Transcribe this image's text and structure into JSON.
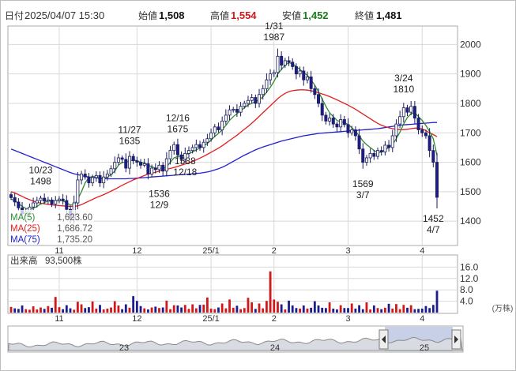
{
  "header": {
    "date_label": "日付",
    "datetime": "2025/04/07 15:30",
    "open_label": "始値",
    "open_value": "1,508",
    "high_label": "高値",
    "high_value": "1,554",
    "low_label": "安値",
    "low_value": "1,452",
    "close_label": "終値",
    "close_value": "1,481"
  },
  "legend": {
    "ma5_label": "MA(5)",
    "ma5_value": "1,623.60",
    "ma25_label": "MA(25)",
    "ma25_value": "1,686.72",
    "ma75_label": "MA(75)",
    "ma75_value": "1,735.20"
  },
  "volume_header": {
    "label": "出来高",
    "value": "93,500株",
    "unit": "(万株)"
  },
  "colors": {
    "up": "#ffffff",
    "down": "#1c1c8c",
    "ma5": "#2e8b2e",
    "ma25": "#e02020",
    "ma75": "#2020d0",
    "volume_up": "#d01818",
    "volume_down": "#1c1c8c",
    "high_value": "#d01818",
    "low_value": "#1a7a1a",
    "grid": "#d8d8d8",
    "navigator_fill": "#c8d0e8"
  },
  "chart_data": {
    "type": "candlestick",
    "price_axis": {
      "ylim": [
        1320,
        2060
      ],
      "ticks": [
        "2000",
        "1900",
        "1800",
        "1700",
        "1600",
        "1500",
        "1400"
      ],
      "tick_values": [
        2000,
        1900,
        1800,
        1700,
        1600,
        1500,
        1400
      ]
    },
    "volume_axis": {
      "ylim": [
        0,
        20
      ],
      "ticks": [
        "16.0",
        "12.0",
        "8.0",
        "4.0"
      ],
      "tick_values": [
        16,
        12,
        8,
        4
      ]
    },
    "month_labels": [
      {
        "label": "11",
        "index": 13
      },
      {
        "label": "12",
        "index": 34
      },
      {
        "label": "25/1",
        "index": 54
      },
      {
        "label": "2",
        "index": 71
      },
      {
        "label": "3",
        "index": 91
      },
      {
        "label": "4",
        "index": 111
      }
    ],
    "annotations": [
      {
        "date": "10/23",
        "value": "1498",
        "index": 8,
        "price": 1498,
        "pos": "above"
      },
      {
        "date": "11/27",
        "value": "1635",
        "index": 32,
        "price": 1635,
        "pos": "above"
      },
      {
        "date": "12/16",
        "value": "1675",
        "index": 45,
        "price": 1675,
        "pos": "above"
      },
      {
        "date": "12/18",
        "value": "1588",
        "index": 47,
        "price": 1588,
        "pos": "left-below"
      },
      {
        "date": "12/9",
        "value": "1536",
        "index": 40,
        "price": 1536,
        "pos": "below"
      },
      {
        "date": "1/31",
        "value": "1987",
        "index": 71,
        "price": 1987,
        "pos": "above"
      },
      {
        "date": "3/7",
        "value": "1569",
        "index": 95,
        "price": 1569,
        "pos": "below"
      },
      {
        "date": "3/24",
        "value": "1810",
        "index": 106,
        "price": 1810,
        "pos": "above"
      },
      {
        "date": "4/7",
        "value": "1452",
        "index": 114,
        "price": 1452,
        "pos": "below"
      }
    ],
    "close": [
      1480,
      1465,
      1445,
      1425,
      1430,
      1448,
      1462,
      1470,
      1478,
      1468,
      1472,
      1458,
      1470,
      1475,
      1470,
      1440,
      1412,
      1462,
      1540,
      1560,
      1550,
      1530,
      1548,
      1555,
      1530,
      1550,
      1560,
      1578,
      1600,
      1615,
      1610,
      1580,
      1620,
      1605,
      1600,
      1590,
      1595,
      1560,
      1580,
      1575,
      1590,
      1570,
      1612,
      1640,
      1660,
      1625,
      1610,
      1630,
      1640,
      1650,
      1660,
      1650,
      1668,
      1680,
      1700,
      1720,
      1710,
      1740,
      1760,
      1778,
      1780,
      1770,
      1790,
      1800,
      1810,
      1820,
      1800,
      1830,
      1850,
      1880,
      1900,
      1905,
      1960,
      1930,
      1945,
      1940,
      1925,
      1900,
      1910,
      1880,
      1890,
      1850,
      1830,
      1800,
      1760,
      1740,
      1750,
      1730,
      1720,
      1745,
      1728,
      1700,
      1710,
      1690,
      1645,
      1600,
      1615,
      1630,
      1620,
      1640,
      1635,
      1658,
      1650,
      1690,
      1730,
      1755,
      1785,
      1770,
      1790,
      1750,
      1710,
      1700,
      1690,
      1640,
      1600,
      1481
    ],
    "ma5": [
      1475,
      1470,
      1460,
      1450,
      1443,
      1442,
      1444,
      1450,
      1458,
      1463,
      1469,
      1468,
      1469,
      1470,
      1469,
      1462,
      1455,
      1455,
      1475,
      1500,
      1530,
      1548,
      1552,
      1550,
      1542,
      1545,
      1550,
      1558,
      1570,
      1590,
      1600,
      1600,
      1605,
      1608,
      1605,
      1600,
      1598,
      1590,
      1585,
      1580,
      1580,
      1578,
      1585,
      1600,
      1615,
      1620,
      1620,
      1625,
      1630,
      1635,
      1642,
      1648,
      1656,
      1664,
      1675,
      1688,
      1698,
      1710,
      1725,
      1742,
      1755,
      1765,
      1775,
      1785,
      1795,
      1800,
      1806,
      1812,
      1822,
      1838,
      1855,
      1875,
      1900,
      1915,
      1930,
      1938,
      1935,
      1925,
      1915,
      1905,
      1895,
      1880,
      1862,
      1840,
      1815,
      1790,
      1768,
      1755,
      1742,
      1738,
      1735,
      1728,
      1718,
      1705,
      1690,
      1672,
      1660,
      1650,
      1640,
      1632,
      1635,
      1642,
      1650,
      1660,
      1680,
      1702,
      1730,
      1752,
      1765,
      1768,
      1755,
      1742,
      1725,
      1705,
      1680,
      1624
    ],
    "ma25": [
      1500,
      1496,
      1490,
      1484,
      1478,
      1473,
      1468,
      1464,
      1461,
      1459,
      1457,
      1455,
      1454,
      1453,
      1452,
      1451,
      1450,
      1450,
      1452,
      1456,
      1462,
      1468,
      1474,
      1480,
      1485,
      1490,
      1496,
      1502,
      1508,
      1515,
      1522,
      1528,
      1534,
      1540,
      1545,
      1550,
      1555,
      1560,
      1563,
      1566,
      1570,
      1573,
      1576,
      1579,
      1582,
      1586,
      1590,
      1594,
      1598,
      1602,
      1608,
      1614,
      1620,
      1627,
      1634,
      1641,
      1648,
      1656,
      1665,
      1674,
      1683,
      1692,
      1702,
      1712,
      1722,
      1733,
      1744,
      1756,
      1768,
      1780,
      1792,
      1804,
      1816,
      1826,
      1834,
      1840,
      1843,
      1845,
      1846,
      1846,
      1845,
      1843,
      1840,
      1836,
      1832,
      1828,
      1823,
      1818,
      1812,
      1806,
      1800,
      1794,
      1787,
      1780,
      1772,
      1764,
      1756,
      1748,
      1740,
      1732,
      1726,
      1721,
      1717,
      1714,
      1712,
      1711,
      1711,
      1712,
      1714,
      1716,
      1716,
      1713,
      1708,
      1700,
      1694,
      1687
    ],
    "ma75": [
      1645,
      1640,
      1635,
      1630,
      1625,
      1620,
      1615,
      1610,
      1605,
      1600,
      1595,
      1590,
      1585,
      1580,
      1575,
      1570,
      1565,
      1561,
      1558,
      1555,
      1552,
      1550,
      1548,
      1547,
      1546,
      1545,
      1544,
      1544,
      1544,
      1544,
      1544,
      1544,
      1545,
      1545,
      1546,
      1547,
      1548,
      1549,
      1550,
      1551,
      1552,
      1553,
      1554,
      1555,
      1556,
      1557,
      1558,
      1559,
      1560,
      1561,
      1562,
      1563,
      1565,
      1567,
      1570,
      1574,
      1578,
      1583,
      1589,
      1596,
      1603,
      1610,
      1617,
      1624,
      1630,
      1636,
      1642,
      1647,
      1652,
      1656,
      1660,
      1664,
      1668,
      1672,
      1675,
      1678,
      1681,
      1684,
      1687,
      1690,
      1692,
      1694,
      1696,
      1698,
      1699,
      1700,
      1701,
      1702,
      1703,
      1704,
      1705,
      1706,
      1707,
      1708,
      1709,
      1710,
      1711,
      1712,
      1713,
      1714,
      1716,
      1718,
      1720,
      1722,
      1724,
      1726,
      1727,
      1728,
      1729,
      1730,
      1731,
      1732,
      1733,
      1734,
      1735,
      1735
    ],
    "volume": [
      2.0,
      1.5,
      1.3,
      2.5,
      1.2,
      1.0,
      2.2,
      1.1,
      1.8,
      1.3,
      2.3,
      1.7,
      5.5,
      1.9,
      1.2,
      2.6,
      1.5,
      1.0,
      3.8,
      2.9,
      1.6,
      1.9,
      3.9,
      1.4,
      2.7,
      1.1,
      1.4,
      1.8,
      4.0,
      2.5,
      1.2,
      2.9,
      1.7,
      5.8,
      4.1,
      2.3,
      1.5,
      1.1,
      1.8,
      2.1,
      1.6,
      1.8,
      4.2,
      1.2,
      2.6,
      2.5,
      1.8,
      2.7,
      1.3,
      2.9,
      1.5,
      2.7,
      2.8,
      5.3,
      1.4,
      1.2,
      1.8,
      3.2,
      1.5,
      4.6,
      1.7,
      2.4,
      1.2,
      1.6,
      5.2,
      3.6,
      1.3,
      3.2,
      1.5,
      4.1,
      14.5,
      4.6,
      3.8,
      2.9,
      1.1,
      4.2,
      2.5,
      1.6,
      1.4,
      2.5,
      1.4,
      1.7,
      4.0,
      2.5,
      1.7,
      1.6,
      3.6,
      1.4,
      1.1,
      2.6,
      1.6,
      1.6,
      3.2,
      1.4,
      2.6,
      1.2,
      3.6,
      1.1,
      2.5,
      1.6,
      1.2,
      1.7,
      3.1,
      1.4,
      3.0,
      1.2,
      2.7,
      1.7,
      2.6,
      1.2,
      1.3,
      1.4,
      2.3,
      1.6,
      2.7,
      7.7
    ]
  },
  "navigator": {
    "labels": [
      {
        "label": "23",
        "x": 157
      },
      {
        "label": "24",
        "x": 348
      },
      {
        "label": "25",
        "x": 537
      }
    ]
  }
}
